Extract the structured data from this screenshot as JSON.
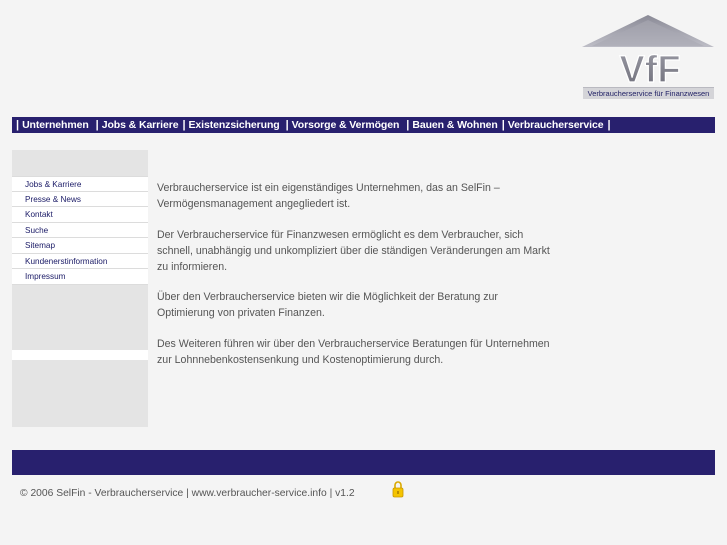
{
  "logo": {
    "text": "VfF",
    "subtitle": "Verbraucherservice für Finanzwesen",
    "accent_color": "#28206e"
  },
  "topnav": {
    "items": [
      "Unternehmen",
      "Jobs & Karriere",
      "Existenzsicherung",
      "Vorsorge & Vermögen",
      "Bauen & Wohnen",
      "Verbraucherservice"
    ],
    "separator": "|"
  },
  "sidebar": {
    "items": [
      "Jobs & Karriere",
      "Presse & News",
      "Kontakt",
      "Suche",
      "Sitemap",
      "Kundenerstinformation",
      "Impressum"
    ]
  },
  "content": {
    "paragraphs": [
      "Verbraucherservice ist ein eigenständiges Unternehmen, das an SelFin – Vermögensmanagement angegliedert ist.",
      "Der Verbraucherservice für Finanzwesen ermöglicht es dem Verbraucher, sich schnell, unabhängig und unkompliziert über die ständigen Veränderungen am Markt zu informieren.",
      "Über den Verbraucherservice bieten wir die Möglichkeit der Beratung zur Optimierung von privaten Finanzen.",
      "Des Weiteren führen wir über den Verbraucherservice Beratungen für Unternehmen zur Lohnnebenkostensenkung und Kostenoptimierung durch."
    ]
  },
  "footer": {
    "text": "© 2006 SelFin - Verbraucherservice | www.verbraucher-service.info | v1.2",
    "lock_icon": "padlock-icon"
  }
}
